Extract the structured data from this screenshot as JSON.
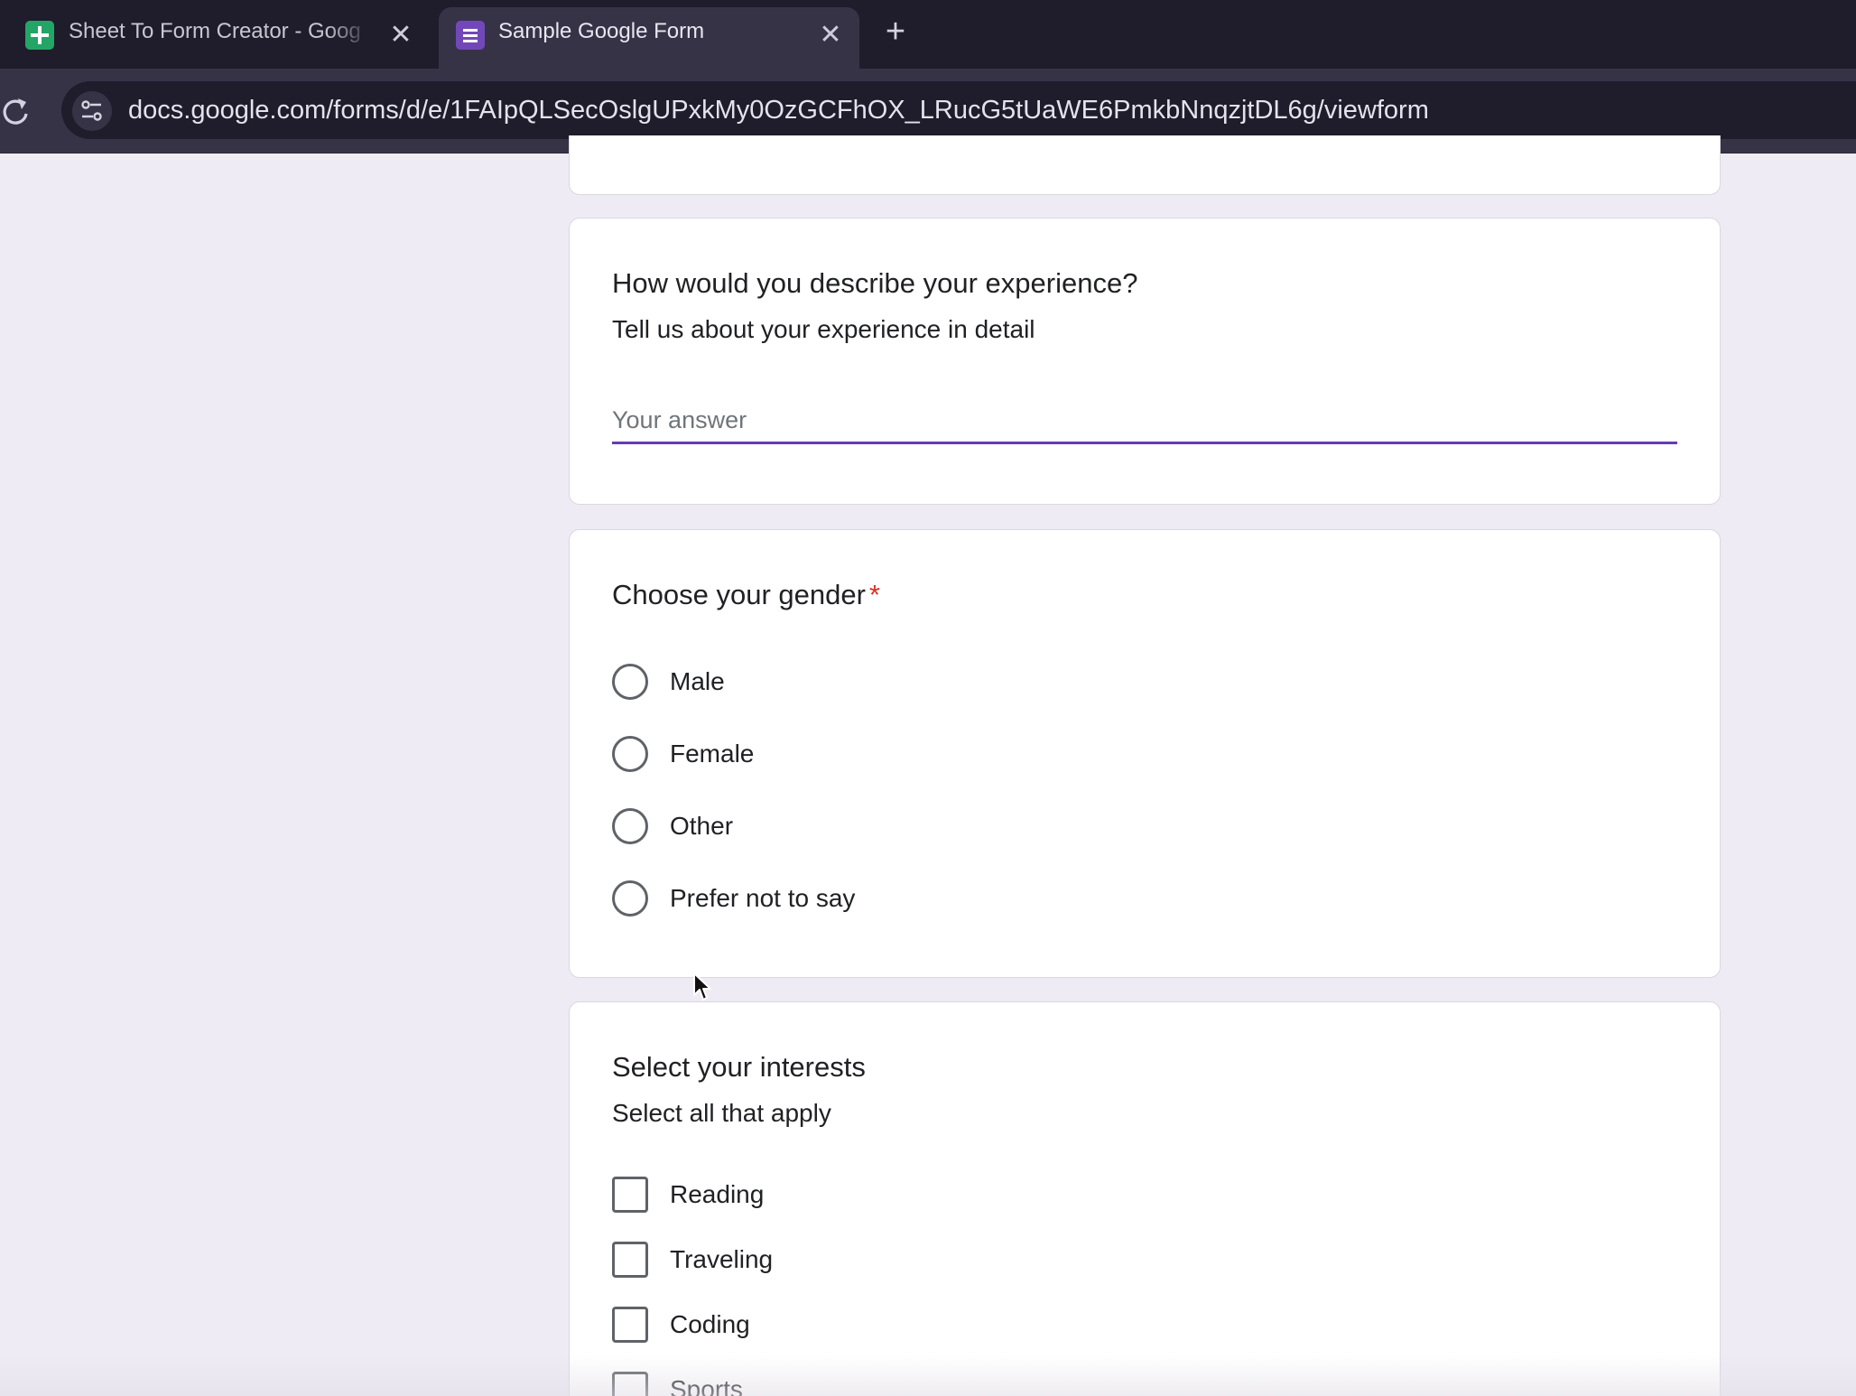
{
  "browser": {
    "tabs": [
      {
        "title": "Sheet To Form Creator - Goog",
        "icon": "google-sheets-icon",
        "active": false
      },
      {
        "title": "Sample Google Form",
        "icon": "google-forms-icon",
        "active": true
      }
    ],
    "close_glyph": "✕",
    "new_tab_glyph": "+",
    "url": "docs.google.com/forms/d/e/1FAIpQLSecOslgUPxkMy0OzGCFhOX_LRucG5tUaWE6PmkbNnqzjtDL6g/viewform"
  },
  "form": {
    "experience": {
      "title": "How would you describe your experience?",
      "description": "Tell us about your experience in detail",
      "placeholder": "Your answer",
      "value": ""
    },
    "gender": {
      "title": "Choose your gender",
      "required_mark": "*",
      "options": [
        "Male",
        "Female",
        "Other",
        "Prefer not to say"
      ]
    },
    "interests": {
      "title": "Select your interests",
      "description": "Select all that apply",
      "options": [
        "Reading",
        "Traveling",
        "Coding",
        "Sports"
      ]
    }
  },
  "colors": {
    "accent": "#673ab7",
    "required": "#d93025",
    "page_background": "#efebf5",
    "tab_bar": "#1f1c2b",
    "toolbar": "#363347"
  }
}
